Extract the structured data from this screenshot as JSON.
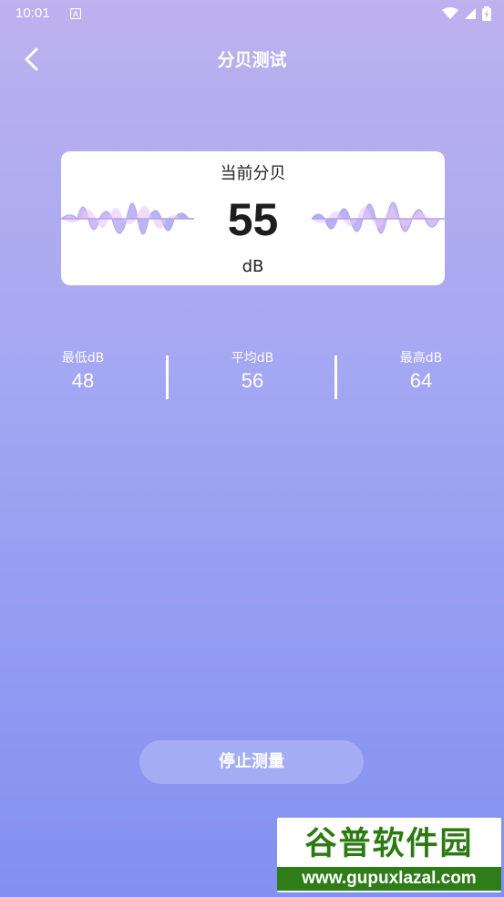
{
  "status_bar": {
    "time": "10:01"
  },
  "header": {
    "title": "分贝测试"
  },
  "meter": {
    "label": "当前分贝",
    "value": "55",
    "unit": "dB"
  },
  "stats": {
    "min": {
      "label": "最低dB",
      "value": "48"
    },
    "avg": {
      "label": "平均dB",
      "value": "56"
    },
    "max": {
      "label": "最高dB",
      "value": "64"
    }
  },
  "actions": {
    "stop_label": "停止测量"
  },
  "watermark": {
    "logo_text": "谷普软件园",
    "url": "www.gupuxlazal.com"
  },
  "colors": {
    "accent": "#8390f1",
    "wave_light": "#d7b7f5",
    "wave_dark": "#9aa3f0"
  }
}
